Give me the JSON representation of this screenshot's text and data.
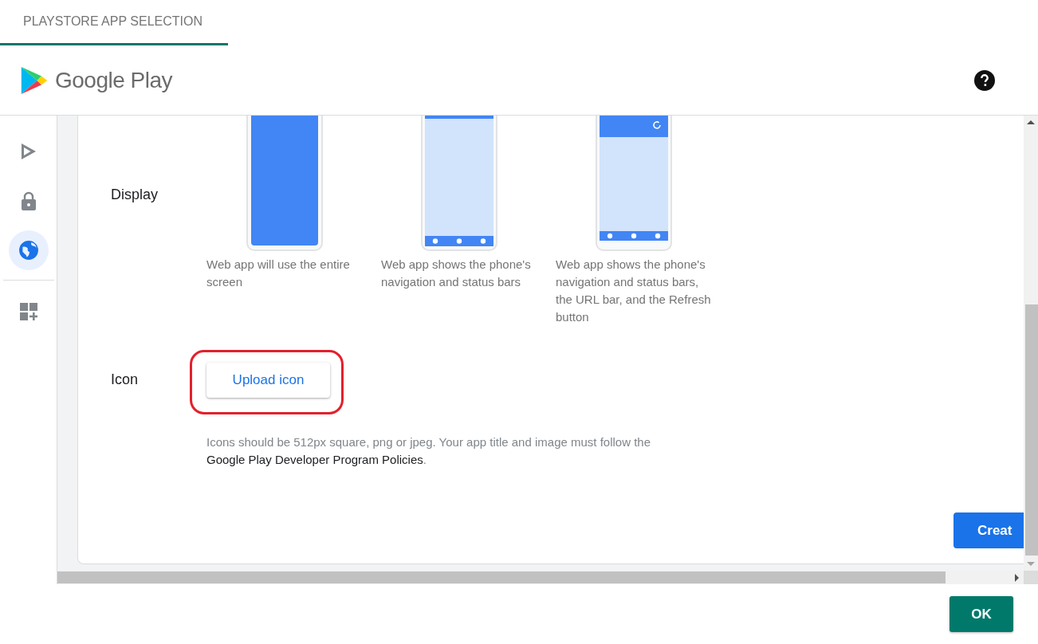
{
  "tab": {
    "label": "PLAYSTORE APP SELECTION",
    "selected": true
  },
  "header": {
    "brand": "Google Play"
  },
  "sidebar": {
    "items": [
      {
        "kind": "play",
        "selected": false
      },
      {
        "kind": "lock",
        "selected": false
      },
      {
        "kind": "globe",
        "selected": true
      },
      {
        "kind": "add-widget",
        "selected": false
      }
    ]
  },
  "form": {
    "display": {
      "label": "Display",
      "options": [
        {
          "kind": "fullscreen",
          "caption": "Web app will use the entire screen"
        },
        {
          "kind": "standalone",
          "caption": "Web app shows the phone's navigation and status bars"
        },
        {
          "kind": "minimal-ui",
          "caption": "Web app shows the phone's navigation and status bars, the URL bar, and the Refresh button"
        }
      ]
    },
    "icon": {
      "label": "Icon",
      "button": "Upload icon",
      "help": "Icons should be 512px square, png or jpeg. Your app title and image must follow the",
      "link": "Google Play Developer Program Policies",
      "suffix": "."
    },
    "create_button": "Creat"
  },
  "footer": {
    "ok_button": "OK"
  }
}
